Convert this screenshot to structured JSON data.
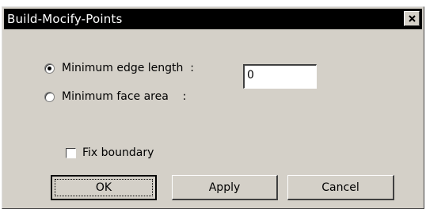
{
  "window": {
    "title": "Build-Mocify-Points"
  },
  "options": {
    "edge_label": "Minimum edge length  :",
    "face_label": "Minimum face area    :",
    "selected": "edge"
  },
  "value_field": {
    "value": "0"
  },
  "fix_boundary": {
    "label": "Fix boundary",
    "checked": false
  },
  "buttons": {
    "ok": "OK",
    "apply": "Apply",
    "cancel": "Cancel"
  }
}
